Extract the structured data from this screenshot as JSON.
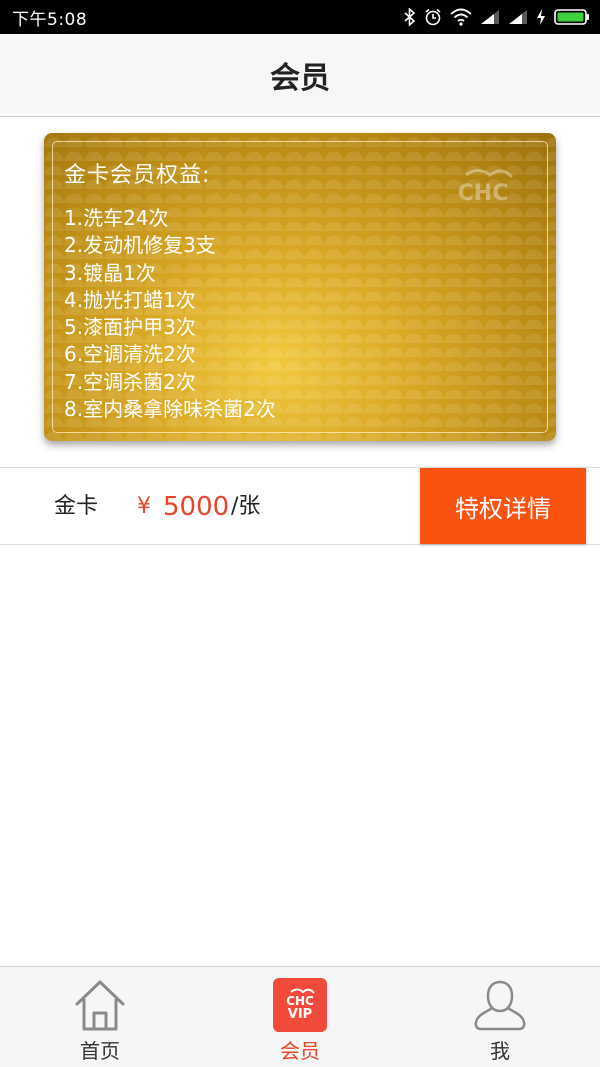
{
  "status_bar": {
    "time": "下午5:08",
    "icons": [
      "bluetooth-icon",
      "alarm-icon",
      "wifi-icon",
      "signal-icon",
      "signal-icon",
      "charging-icon",
      "battery-icon"
    ]
  },
  "header": {
    "title": "会员"
  },
  "card": {
    "title": "金卡会员权益:",
    "logo": "CHC",
    "benefits": [
      "1.洗车24次",
      "2.发动机修复3支",
      "3.镀晶1次",
      "4.抛光打蜡1次",
      "5.漆面护甲3次",
      "6.空调清洗2次",
      "7.空调杀菌2次",
      "8.室内桑拿除味杀菌2次"
    ]
  },
  "price_row": {
    "name": "金卡",
    "currency": "¥",
    "amount": "5000",
    "unit": "/张",
    "button_label": "特权详情"
  },
  "tabs": [
    {
      "label": "首页",
      "icon": "home-icon",
      "active": false
    },
    {
      "label": "会员",
      "icon": "vip-icon",
      "badge_logo": "CHC",
      "badge_text": "VIP",
      "active": true
    },
    {
      "label": "我",
      "icon": "profile-icon",
      "active": false
    }
  ],
  "colors": {
    "accent": "#fa5211",
    "price": "#e8452c",
    "active_tab": "#e8452c",
    "card_gold": "#d9a724"
  }
}
